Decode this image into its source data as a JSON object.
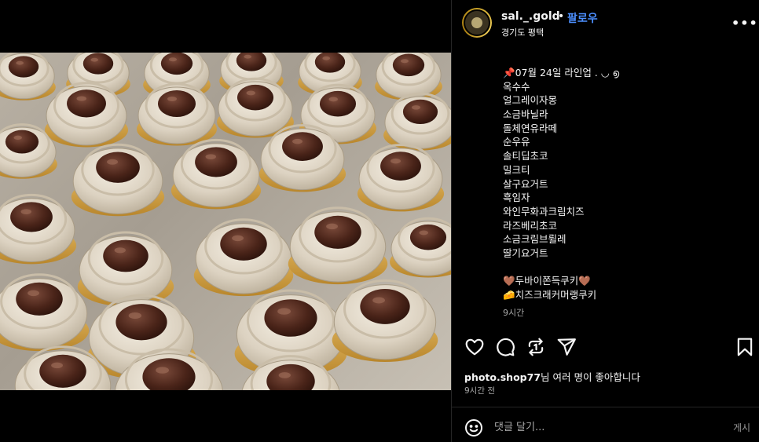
{
  "post": {
    "username": "sal._.gold",
    "separator": "•",
    "follow_label": "팔로우",
    "location": "경기도 평택",
    "more_icon": "more-horizontal-icon"
  },
  "caption": {
    "lines": [
      "📌07월 24일 라인업 . ◡ ൭",
      "옥수수",
      "얼그레이자몽",
      "소금바닐라",
      "돌체연유라떼",
      "순우유",
      "솔티딥초코",
      "밀크티",
      "살구요거트",
      "흑임자",
      "와인무화과크림치즈",
      "라즈베리초코",
      "소금크림브륄레",
      "딸기요거트",
      "",
      "🤎두바이쫀득쿠키🤎",
      "🧀치즈크래커머랭쿠키"
    ],
    "time": "9시간"
  },
  "actions": {
    "like_icon": "heart-icon",
    "comment_icon": "comment-icon",
    "repost_icon": "repost-icon",
    "share_icon": "share-icon",
    "save_icon": "bookmark-icon"
  },
  "likes": {
    "user": "photo.shop77",
    "text": "님 여러 명이 좋아합니다"
  },
  "posted_time": "9시간 전",
  "comment": {
    "placeholder": "댓글 달기...",
    "post_label": "게시",
    "emoji_icon": "smiley-icon"
  },
  "colors": {
    "background": "#000000",
    "text": "#f5f5f5",
    "secondary": "#a8a8a8",
    "follow": "#4c8fff"
  }
}
